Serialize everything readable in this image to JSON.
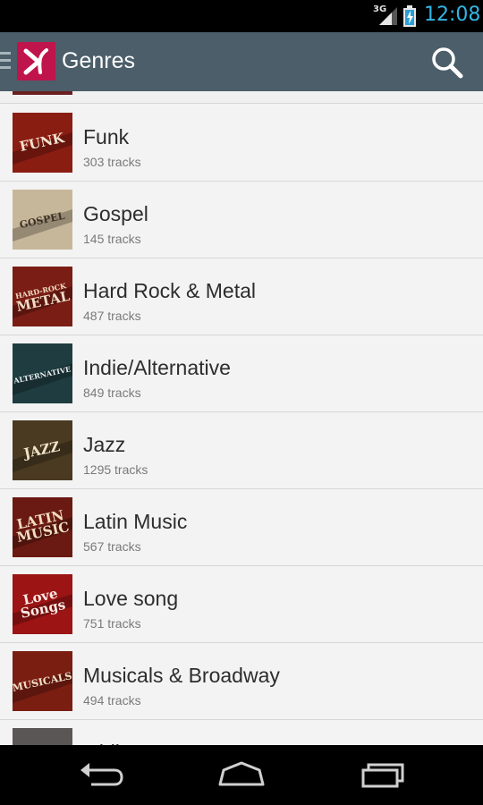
{
  "status_bar": {
    "network": "3G",
    "time": "12:08"
  },
  "action_bar": {
    "title": "Genres"
  },
  "genres": [
    {
      "name": "Funk",
      "count": "303 tracks",
      "art": "FUNK",
      "bg": "#8a1d12",
      "fg": "#f1e2cf"
    },
    {
      "name": "Gospel",
      "count": "145 tracks",
      "art": "GOSPEL",
      "bg": "#c7b79a",
      "fg": "#3a3024"
    },
    {
      "name": "Hard Rock & Metal",
      "count": "487 tracks",
      "art": "HARD-ROCK METAL",
      "bg": "#7a1d14",
      "fg": "#f0dcc4"
    },
    {
      "name": "Indie/Alternative",
      "count": "849 tracks",
      "art": "ALTERNATIVE",
      "bg": "#1f3d40",
      "fg": "#e8eef0"
    },
    {
      "name": "Jazz",
      "count": "1295 tracks",
      "art": "JAZZ",
      "bg": "#4a3a22",
      "fg": "#efe4c8"
    },
    {
      "name": "Latin Music",
      "count": "567 tracks",
      "art": "LATIN MUSIC",
      "bg": "#6a1a12",
      "fg": "#f2dcc0"
    },
    {
      "name": "Love song",
      "count": "751 tracks",
      "art": "Love Songs",
      "bg": "#9c1414",
      "fg": "#fbe9e4"
    },
    {
      "name": "Musicals & Broadway",
      "count": "494 tracks",
      "art": "MUSICALS",
      "bg": "#7b1e12",
      "fg": "#f1e0c8"
    },
    {
      "name": "Oldies & Retro",
      "count": "",
      "art": "",
      "bg": "#5a5656",
      "fg": "#dddddd"
    }
  ],
  "colors": {
    "action_bar": "#4b5e69",
    "accent_clock": "#33b5e5",
    "logo": "#c0144c",
    "list_bg": "#f3f3f3"
  },
  "icons": {
    "drawer": "drawer-indicator-icon",
    "logo": "app-logo-icon",
    "search": "search-icon",
    "back": "back-icon",
    "home": "home-icon",
    "recents": "recents-icon"
  }
}
